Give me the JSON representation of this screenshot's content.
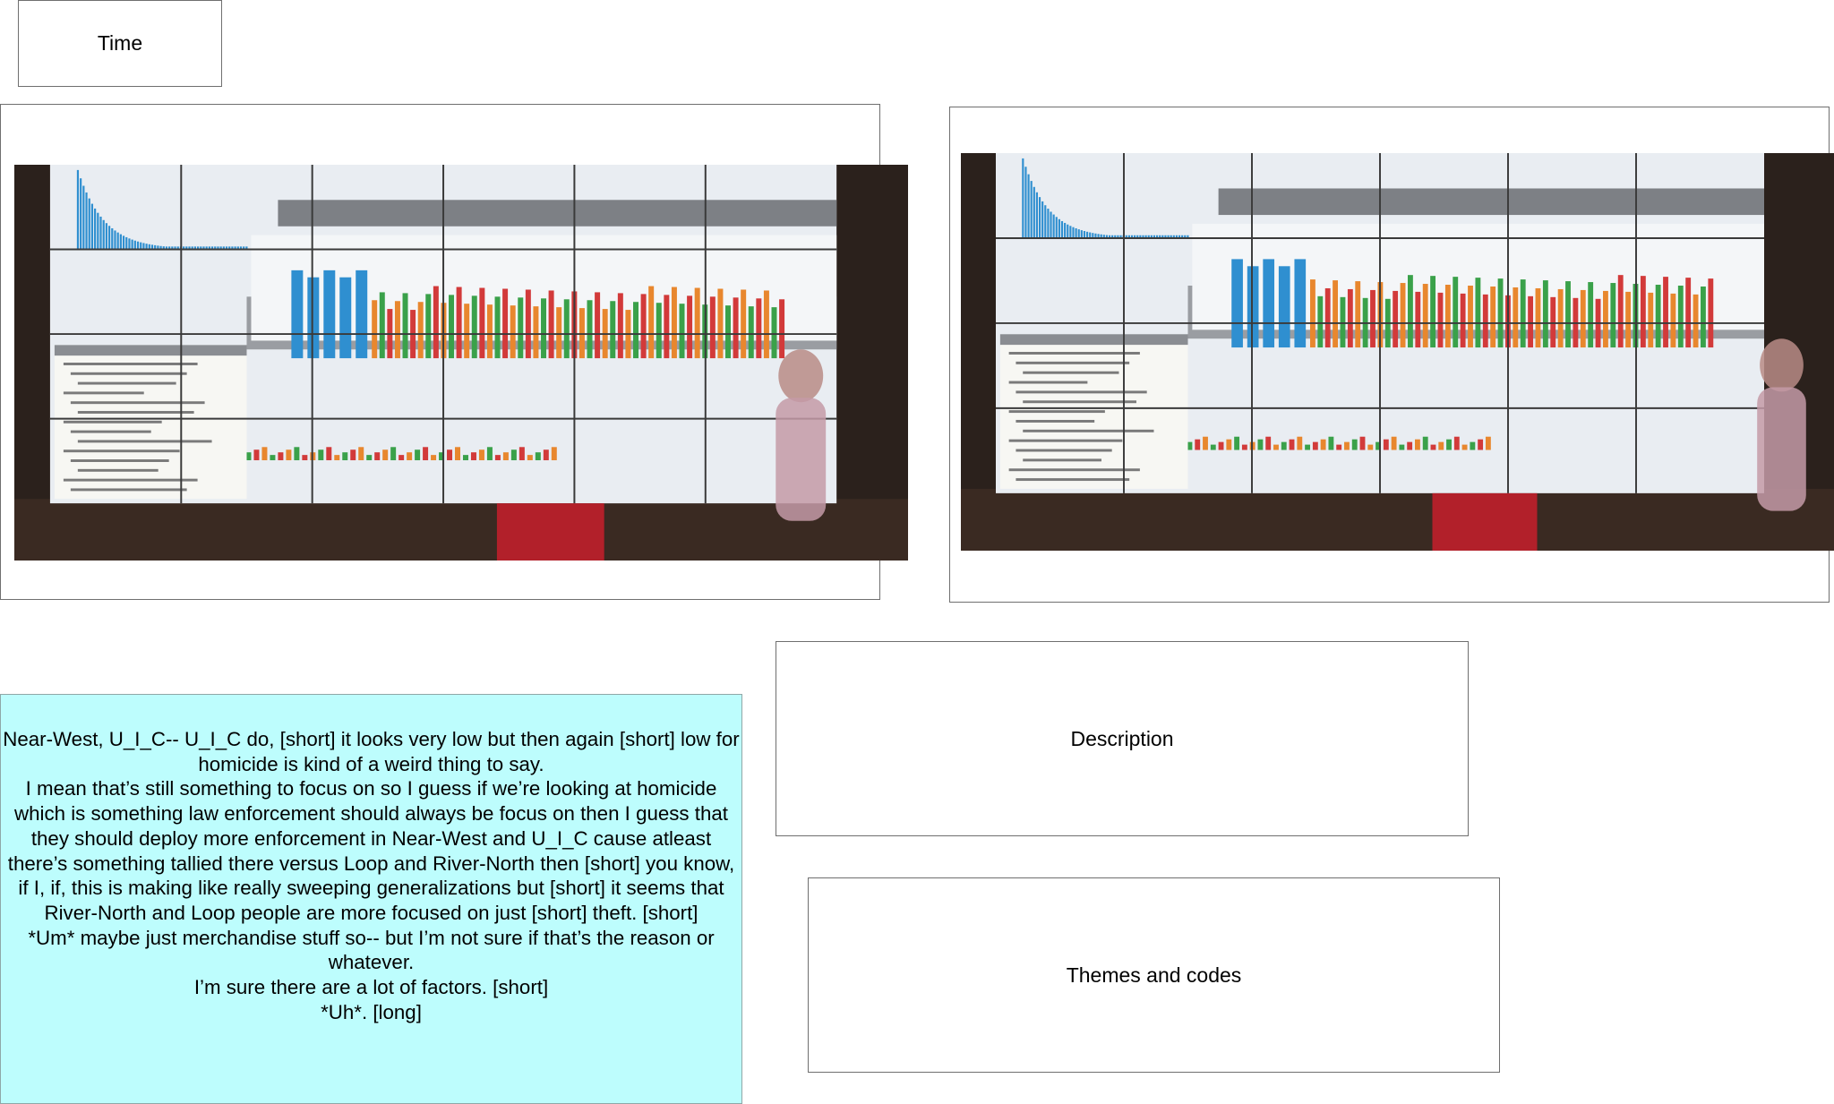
{
  "labels": {
    "time": "Time",
    "description": "Description",
    "themes": "Themes and codes"
  },
  "photos": [
    {
      "name": "wall-display-photo-1"
    },
    {
      "name": "wall-display-photo-2"
    }
  ],
  "transcript": {
    "paragraphs": [
      "Near-West, U_I_C-- U_I_C do, [short] it looks very low but then again [short] low for homicide is kind of a weird thing to say.",
      "I mean that’s still something to focus on so I guess if we’re looking at homicide which is something law enforcement should always be focus on then I guess that they should deploy more enforcement in Near-West and U_I_C cause atleast there’s something tallied there versus Loop and River-North then [short] you know, if I, if, this is making like really sweeping generalizations but [short] it seems that River-North and Loop people are more focused on just [short] theft. [short]",
      "*Um* maybe just merchandise stuff so-- but I’m not sure if that’s the reason or whatever.",
      "I’m sure there are a lot of factors. [short]",
      "*Uh*. [long]"
    ]
  },
  "colors": {
    "transcript_bg": "#bdfdfd",
    "bar_blue": "#2f8fd0",
    "bar_orange": "#e8872e",
    "bar_green": "#3aa14a",
    "bar_red": "#d23a3a",
    "banner_red": "#b2202a"
  }
}
